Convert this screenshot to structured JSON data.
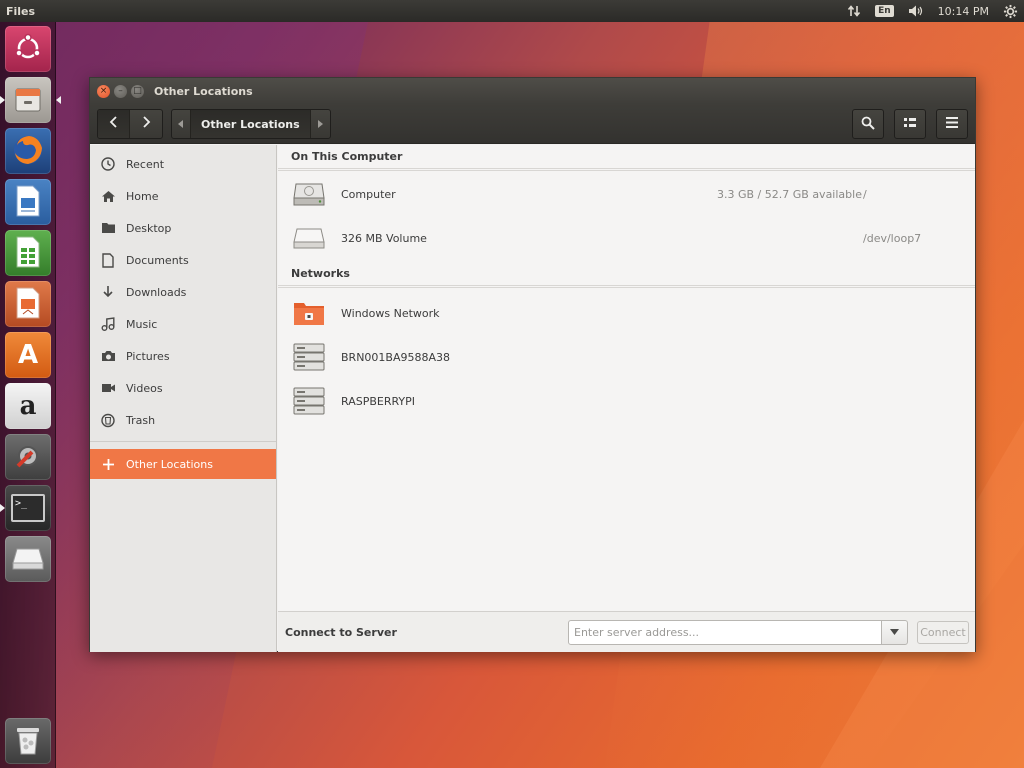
{
  "top_panel": {
    "app_name": "Files",
    "keyboard_layout": "En",
    "clock": "10:14 PM"
  },
  "launcher": {
    "items": [
      {
        "name": "dash",
        "icon": "ubuntu-logo-icon"
      },
      {
        "name": "files",
        "icon": "file-cabinet-icon"
      },
      {
        "name": "firefox",
        "icon": "firefox-icon"
      },
      {
        "name": "writer",
        "icon": "libreoffice-writer-icon"
      },
      {
        "name": "calc",
        "icon": "libreoffice-calc-icon"
      },
      {
        "name": "impress",
        "icon": "libreoffice-impress-icon"
      },
      {
        "name": "software",
        "icon": "software-center-icon"
      },
      {
        "name": "amazon",
        "icon": "amazon-icon"
      },
      {
        "name": "settings",
        "icon": "system-settings-icon"
      },
      {
        "name": "terminal",
        "icon": "terminal-icon"
      },
      {
        "name": "drive",
        "icon": "removable-drive-icon"
      },
      {
        "name": "trash",
        "icon": "trash-icon"
      }
    ],
    "amazon_glyph": "a",
    "software_glyph": "A",
    "terminal_glyph": ">_"
  },
  "window": {
    "title": "Other Locations",
    "path_label": "Other Locations",
    "close_glyph": "×",
    "min_glyph": "–",
    "max_glyph": "□"
  },
  "sidebar": {
    "items": [
      {
        "label": "Recent",
        "icon": "clock-icon"
      },
      {
        "label": "Home",
        "icon": "home-icon"
      },
      {
        "label": "Desktop",
        "icon": "folder-icon"
      },
      {
        "label": "Documents",
        "icon": "document-icon"
      },
      {
        "label": "Downloads",
        "icon": "download-arrow-icon"
      },
      {
        "label": "Music",
        "icon": "music-note-icon"
      },
      {
        "label": "Pictures",
        "icon": "camera-icon"
      },
      {
        "label": "Videos",
        "icon": "video-camera-icon"
      },
      {
        "label": "Trash",
        "icon": "trash-icon"
      }
    ],
    "other_locations": {
      "label": "Other Locations",
      "icon": "plus-icon"
    }
  },
  "content": {
    "on_this_computer": "On This Computer",
    "computer": {
      "name": "Computer",
      "info": "3.3 GB / 52.7 GB available",
      "mount": "/"
    },
    "volume": {
      "name": "326 MB Volume",
      "mount": "/dev/loop7"
    },
    "networks": "Networks",
    "network_items": [
      {
        "name": "Windows Network"
      },
      {
        "name": "BRN001BA9588A38"
      },
      {
        "name": "RASPBERRYPI"
      }
    ]
  },
  "connect": {
    "label": "Connect to Server",
    "placeholder": "Enter server address...",
    "button": "Connect"
  },
  "colors": {
    "accent": "#f07746",
    "panel": "#3c3b37"
  }
}
